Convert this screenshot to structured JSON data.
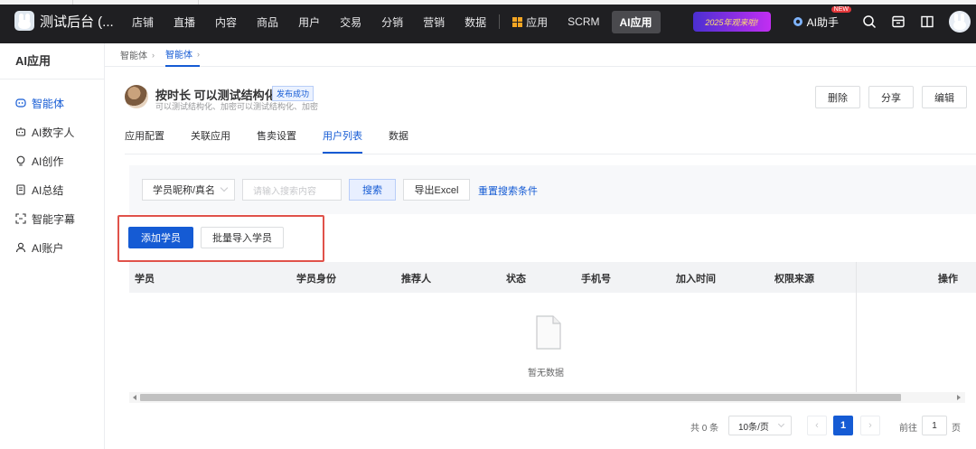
{
  "topbar": {
    "brand": "测试后台 (...",
    "nav": [
      "店铺",
      "直播",
      "内容",
      "商品",
      "用户",
      "交易",
      "分销",
      "营销",
      "数据"
    ],
    "apps_label": "应用",
    "scrm_label": "SCRM",
    "ai_app_label": "AI应用",
    "banner_text": "2025年观来啦!",
    "ai_helper_label": "AI助手",
    "new_badge": "NEW"
  },
  "sidebar": {
    "title": "AI应用",
    "items": [
      {
        "label": "智能体",
        "icon": "agent-icon"
      },
      {
        "label": "AI数字人",
        "icon": "robot-icon"
      },
      {
        "label": "AI创作",
        "icon": "bulb-icon"
      },
      {
        "label": "AI总结",
        "icon": "document-icon"
      },
      {
        "label": "智能字幕",
        "icon": "subtitle-icon"
      },
      {
        "label": "AI账户",
        "icon": "user-icon"
      }
    ]
  },
  "breadcrumb": {
    "items": [
      "智能体",
      "智能体"
    ]
  },
  "agent": {
    "name": "按时长 可以测试结构化",
    "status": "发布成功",
    "description": "可以测试结构化、加密可以测试结构化、加密"
  },
  "actions": {
    "delete": "删除",
    "share": "分享",
    "edit": "编辑"
  },
  "tabs": [
    "应用配置",
    "关联应用",
    "售卖设置",
    "用户列表",
    "数据"
  ],
  "filter": {
    "select_value": "学员昵称/真名",
    "search_placeholder": "请输入搜索内容",
    "search_button": "搜索",
    "export_button": "导出Excel",
    "reset_link": "重置搜索条件"
  },
  "buttons": {
    "add": "添加学员",
    "import": "批量导入学员"
  },
  "table": {
    "columns": [
      "学员",
      "学员身份",
      "推荐人",
      "状态",
      "手机号",
      "加入时间",
      "权限来源",
      "操作"
    ],
    "empty_text": "暂无数据"
  },
  "pagination": {
    "total": "共 0 条",
    "page_size": "10条/页",
    "current_page": "1",
    "goto_label": "前往",
    "goto_value": "1",
    "goto_unit": "页"
  },
  "colors": {
    "primary": "#155bd4",
    "topbar": "#1f1f22",
    "highlight_border": "#e0524a"
  }
}
